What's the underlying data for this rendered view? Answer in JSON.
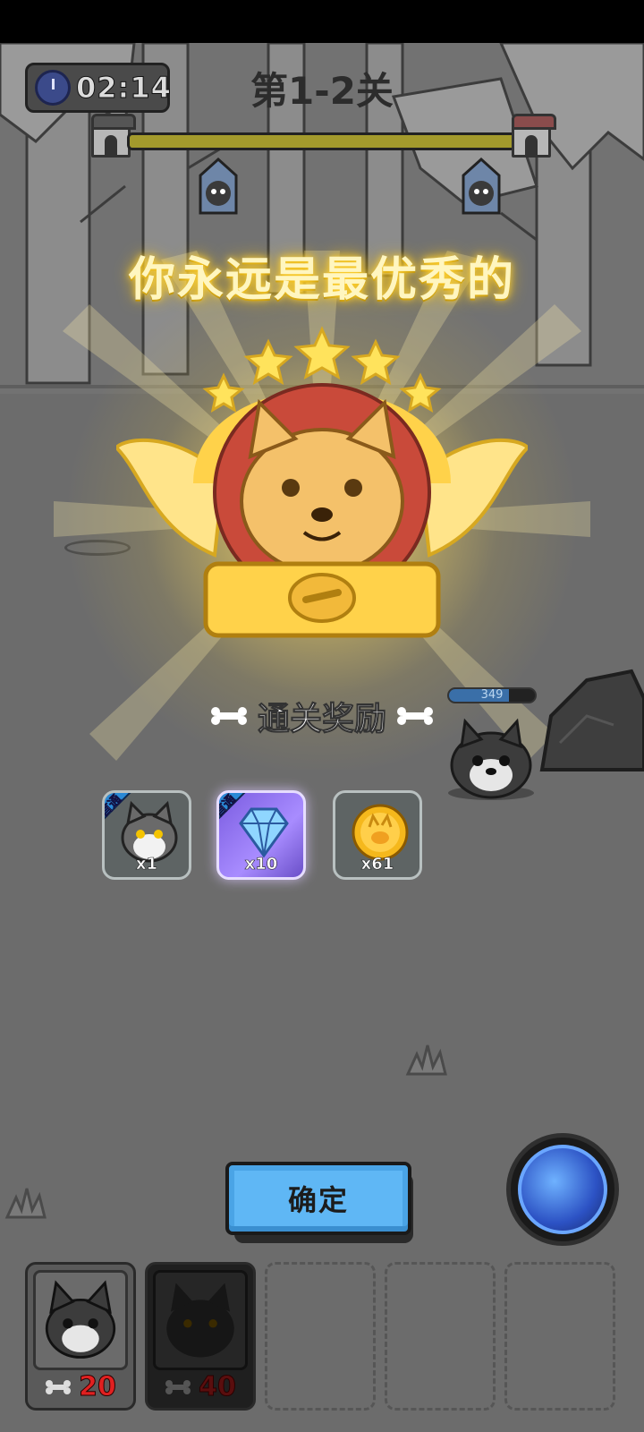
{
  "hud": {
    "timer": "02:14",
    "level_title": "第1-2关",
    "progress_fraction": 1.0
  },
  "victory": {
    "slogan": "你永远是最优秀的",
    "reward_title": "通关奖励"
  },
  "enemy": {
    "hp": "349",
    "hp_fraction": 0.7
  },
  "rewards": [
    {
      "icon": "husky-unit-icon",
      "count": "x1",
      "first_clear": true,
      "first_label": "首通"
    },
    {
      "icon": "diamond-icon",
      "count": "x10",
      "first_clear": true,
      "first_label": "首通"
    },
    {
      "icon": "coin-icon",
      "count": "x61",
      "first_clear": false
    }
  ],
  "confirm_label": "确定",
  "units": [
    {
      "cost": "20",
      "state": "available"
    },
    {
      "cost": "40",
      "state": "locked"
    },
    {
      "state": "empty"
    },
    {
      "state": "empty"
    },
    {
      "state": "empty"
    }
  ],
  "colors": {
    "gold": "#ffd33a",
    "confirm": "#5fb7f5",
    "cost": "#e02020"
  }
}
